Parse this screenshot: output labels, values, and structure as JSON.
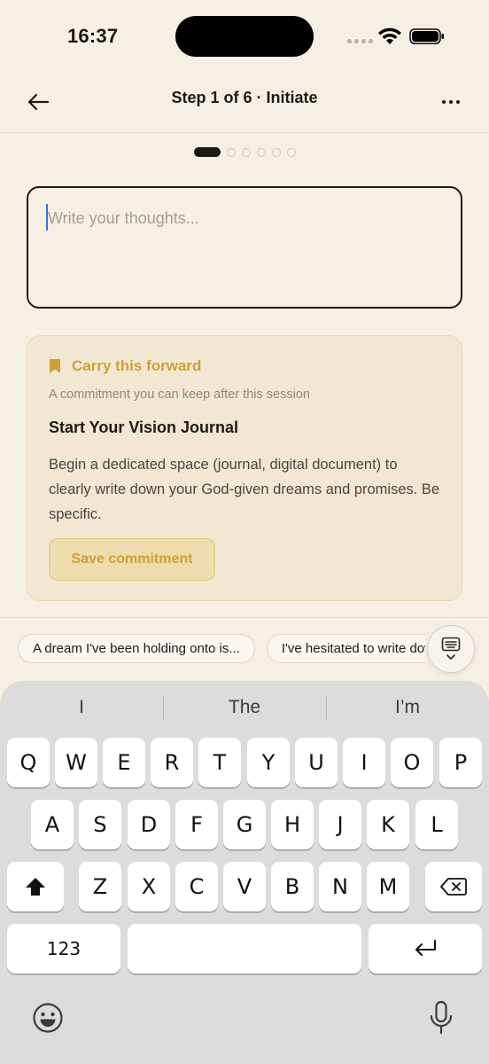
{
  "status_bar": {
    "time": "16:37"
  },
  "header": {
    "title": "Step 1 of 6 · Initiate"
  },
  "progress": {
    "current_step": 1,
    "total_steps": 6
  },
  "thoughts_input": {
    "placeholder": "Write your thoughts...",
    "value": ""
  },
  "card": {
    "label": "Carry this forward",
    "subtitle": "A commitment you can keep after this session",
    "title": "Start Your Vision Journal",
    "body": "Begin a dedicated space (journal, digital document) to clearly write down your God-given dreams and promises. Be specific.",
    "save_label": "Save commitment"
  },
  "chips": [
    "A dream I've been holding onto is...",
    "I've hesitated to write down..."
  ],
  "keyboard": {
    "suggestions": [
      "I",
      "The",
      "I’m"
    ],
    "row1": [
      "Q",
      "W",
      "E",
      "R",
      "T",
      "Y",
      "U",
      "I",
      "O",
      "P"
    ],
    "row2": [
      "A",
      "S",
      "D",
      "F",
      "G",
      "H",
      "J",
      "K",
      "L"
    ],
    "row3": [
      "Z",
      "X",
      "C",
      "V",
      "B",
      "N",
      "M"
    ],
    "numbers_label": "123"
  },
  "icons": {
    "back": "arrow-left-icon",
    "more": "more-horizontal-icon",
    "bookmark": "bookmark-icon",
    "keyboard_toggle": "keyboard-hide-icon",
    "shift": "shift-icon",
    "delete": "backspace-icon",
    "return": "return-icon",
    "emoji": "emoji-icon",
    "mic": "microphone-icon"
  },
  "colors": {
    "background": "#f6efe4",
    "accent_gold": "#cda232",
    "card_bg": "#f2e7d3",
    "text": "#1d1a16"
  }
}
